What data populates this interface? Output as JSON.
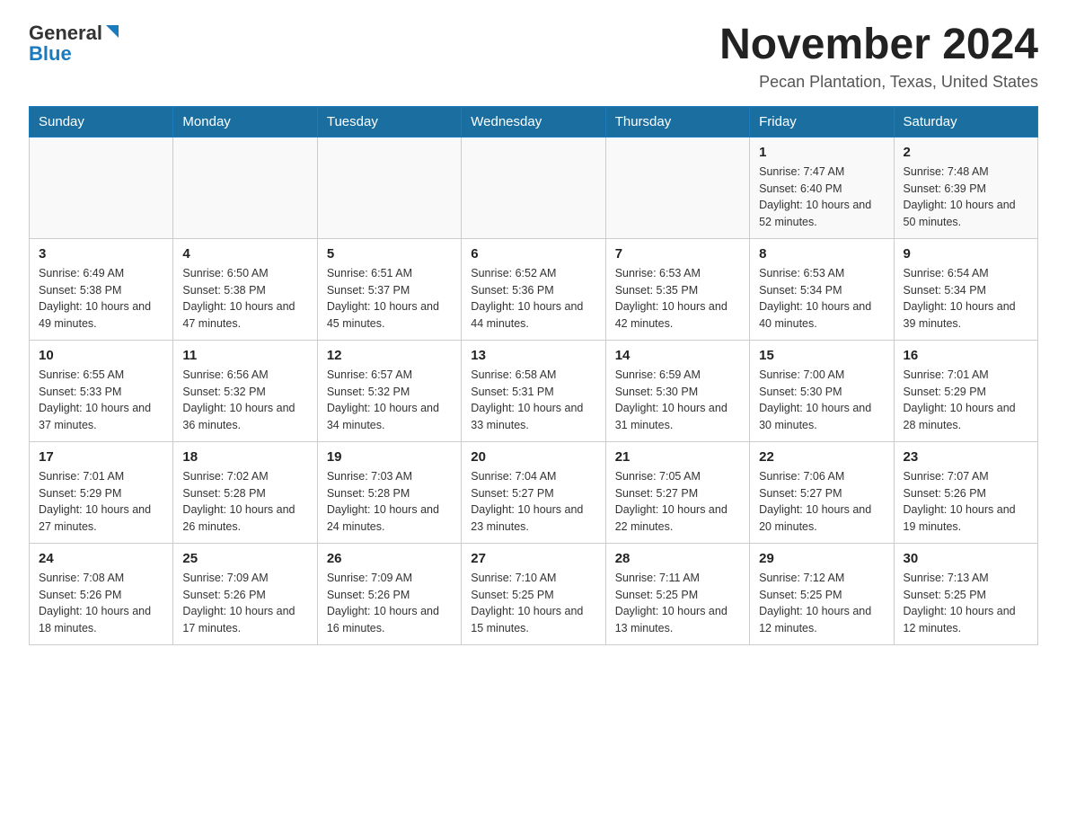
{
  "logo": {
    "general": "General",
    "blue": "Blue"
  },
  "title": "November 2024",
  "subtitle": "Pecan Plantation, Texas, United States",
  "days_of_week": [
    "Sunday",
    "Monday",
    "Tuesday",
    "Wednesday",
    "Thursday",
    "Friday",
    "Saturday"
  ],
  "weeks": [
    [
      {
        "day": "",
        "info": ""
      },
      {
        "day": "",
        "info": ""
      },
      {
        "day": "",
        "info": ""
      },
      {
        "day": "",
        "info": ""
      },
      {
        "day": "",
        "info": ""
      },
      {
        "day": "1",
        "info": "Sunrise: 7:47 AM\nSunset: 6:40 PM\nDaylight: 10 hours and 52 minutes."
      },
      {
        "day": "2",
        "info": "Sunrise: 7:48 AM\nSunset: 6:39 PM\nDaylight: 10 hours and 50 minutes."
      }
    ],
    [
      {
        "day": "3",
        "info": "Sunrise: 6:49 AM\nSunset: 5:38 PM\nDaylight: 10 hours and 49 minutes."
      },
      {
        "day": "4",
        "info": "Sunrise: 6:50 AM\nSunset: 5:38 PM\nDaylight: 10 hours and 47 minutes."
      },
      {
        "day": "5",
        "info": "Sunrise: 6:51 AM\nSunset: 5:37 PM\nDaylight: 10 hours and 45 minutes."
      },
      {
        "day": "6",
        "info": "Sunrise: 6:52 AM\nSunset: 5:36 PM\nDaylight: 10 hours and 44 minutes."
      },
      {
        "day": "7",
        "info": "Sunrise: 6:53 AM\nSunset: 5:35 PM\nDaylight: 10 hours and 42 minutes."
      },
      {
        "day": "8",
        "info": "Sunrise: 6:53 AM\nSunset: 5:34 PM\nDaylight: 10 hours and 40 minutes."
      },
      {
        "day": "9",
        "info": "Sunrise: 6:54 AM\nSunset: 5:34 PM\nDaylight: 10 hours and 39 minutes."
      }
    ],
    [
      {
        "day": "10",
        "info": "Sunrise: 6:55 AM\nSunset: 5:33 PM\nDaylight: 10 hours and 37 minutes."
      },
      {
        "day": "11",
        "info": "Sunrise: 6:56 AM\nSunset: 5:32 PM\nDaylight: 10 hours and 36 minutes."
      },
      {
        "day": "12",
        "info": "Sunrise: 6:57 AM\nSunset: 5:32 PM\nDaylight: 10 hours and 34 minutes."
      },
      {
        "day": "13",
        "info": "Sunrise: 6:58 AM\nSunset: 5:31 PM\nDaylight: 10 hours and 33 minutes."
      },
      {
        "day": "14",
        "info": "Sunrise: 6:59 AM\nSunset: 5:30 PM\nDaylight: 10 hours and 31 minutes."
      },
      {
        "day": "15",
        "info": "Sunrise: 7:00 AM\nSunset: 5:30 PM\nDaylight: 10 hours and 30 minutes."
      },
      {
        "day": "16",
        "info": "Sunrise: 7:01 AM\nSunset: 5:29 PM\nDaylight: 10 hours and 28 minutes."
      }
    ],
    [
      {
        "day": "17",
        "info": "Sunrise: 7:01 AM\nSunset: 5:29 PM\nDaylight: 10 hours and 27 minutes."
      },
      {
        "day": "18",
        "info": "Sunrise: 7:02 AM\nSunset: 5:28 PM\nDaylight: 10 hours and 26 minutes."
      },
      {
        "day": "19",
        "info": "Sunrise: 7:03 AM\nSunset: 5:28 PM\nDaylight: 10 hours and 24 minutes."
      },
      {
        "day": "20",
        "info": "Sunrise: 7:04 AM\nSunset: 5:27 PM\nDaylight: 10 hours and 23 minutes."
      },
      {
        "day": "21",
        "info": "Sunrise: 7:05 AM\nSunset: 5:27 PM\nDaylight: 10 hours and 22 minutes."
      },
      {
        "day": "22",
        "info": "Sunrise: 7:06 AM\nSunset: 5:27 PM\nDaylight: 10 hours and 20 minutes."
      },
      {
        "day": "23",
        "info": "Sunrise: 7:07 AM\nSunset: 5:26 PM\nDaylight: 10 hours and 19 minutes."
      }
    ],
    [
      {
        "day": "24",
        "info": "Sunrise: 7:08 AM\nSunset: 5:26 PM\nDaylight: 10 hours and 18 minutes."
      },
      {
        "day": "25",
        "info": "Sunrise: 7:09 AM\nSunset: 5:26 PM\nDaylight: 10 hours and 17 minutes."
      },
      {
        "day": "26",
        "info": "Sunrise: 7:09 AM\nSunset: 5:26 PM\nDaylight: 10 hours and 16 minutes."
      },
      {
        "day": "27",
        "info": "Sunrise: 7:10 AM\nSunset: 5:25 PM\nDaylight: 10 hours and 15 minutes."
      },
      {
        "day": "28",
        "info": "Sunrise: 7:11 AM\nSunset: 5:25 PM\nDaylight: 10 hours and 13 minutes."
      },
      {
        "day": "29",
        "info": "Sunrise: 7:12 AM\nSunset: 5:25 PM\nDaylight: 10 hours and 12 minutes."
      },
      {
        "day": "30",
        "info": "Sunrise: 7:13 AM\nSunset: 5:25 PM\nDaylight: 10 hours and 12 minutes."
      }
    ]
  ]
}
